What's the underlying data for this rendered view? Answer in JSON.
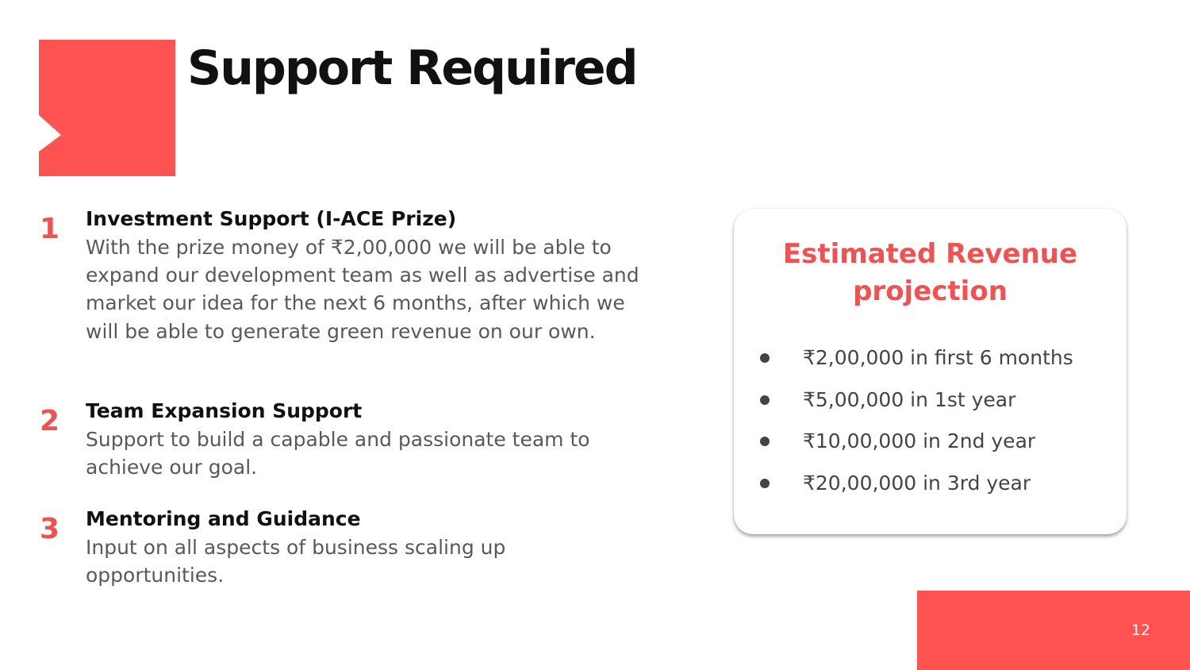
{
  "slide": {
    "title": "Support Required",
    "accent_color": "#ff5352",
    "number_color": "#f05252",
    "page_number": "12"
  },
  "items": [
    {
      "number": "1",
      "heading": "Investment Support (I-ACE Prize)",
      "body": "With the prize money of ₹2,00,000 we will be able to expand our development team as well as advertise and market our idea for the next 6 months, after which we will be able to generate green revenue on our own."
    },
    {
      "number": "2",
      "heading": "Team Expansion Support",
      "body": "Support to build a capable and passionate team to achieve our goal."
    },
    {
      "number": "3",
      "heading": "Mentoring and Guidance",
      "body": "Input on all aspects of business scaling up opportunities."
    }
  ],
  "revenue_card": {
    "title": "Estimated Revenue projection",
    "projections": [
      "₹2,00,000 in first 6 months",
      "₹5,00,000 in 1st year",
      "₹10,00,000 in 2nd year",
      "₹20,00,000 in 3rd year"
    ]
  }
}
